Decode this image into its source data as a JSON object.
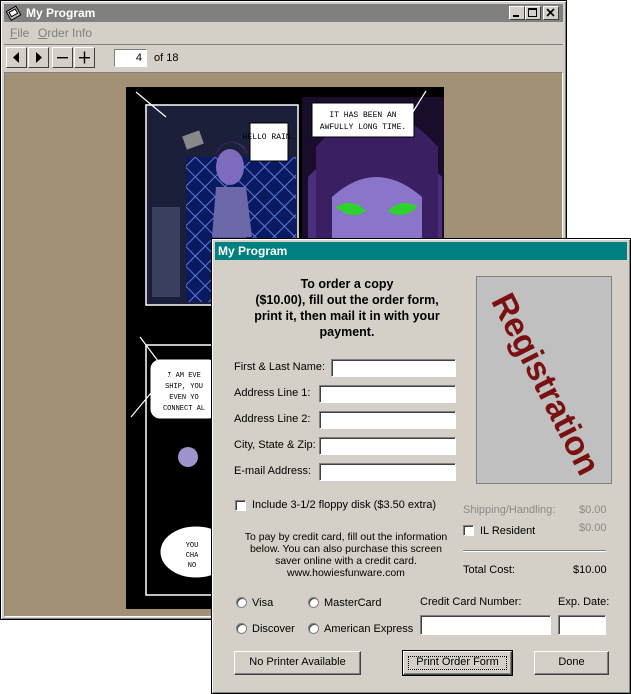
{
  "window": {
    "title": "My Program",
    "menu": [
      "File",
      "Order Info"
    ],
    "toolbar": {
      "page_value": "4",
      "page_of": "of 18"
    },
    "comic_bubbles": [
      "HELLO RAIN.",
      "IT HAS BEEN AN AWFULLY LONG TIME.",
      "I AM EVE SHIP, YOU EVEN YO CONNECT AL",
      "YOU CHA NO"
    ]
  },
  "dialog": {
    "title": "My Program",
    "heading": [
      "To order a copy",
      "($10.00), fill out the order form,",
      "print it, then mail it in with your",
      "payment."
    ],
    "registration_text": "Registration",
    "fields": {
      "name_label": "First & Last Name:",
      "addr1_label": "Address Line 1:",
      "addr2_label": "Address Line 2:",
      "csz_label": "City, State & Zip:",
      "email_label": "E-mail Address:"
    },
    "floppy_label": "Include 3-1/2 floppy disk ($3.50 extra)",
    "shipping_label": "Shipping/Handling:",
    "shipping_value": "$0.00",
    "il_label": "IL Resident",
    "il_value": "$0.00",
    "total_label": "Total Cost:",
    "total_value": "$10.00",
    "info_lines": [
      "To pay by credit card, fill out the information",
      "below. You can also purchase this screen",
      "saver online with a credit card.",
      "www.howiesfunware.com"
    ],
    "cards": {
      "visa": "Visa",
      "mastercard": "MasterCard",
      "discover": "Discover",
      "amex": "American Express"
    },
    "cc_number_label": "Credit Card Number:",
    "exp_label": "Exp. Date:",
    "buttons": {
      "no_printer": "No Printer Available",
      "print": "Print Order Form",
      "done": "Done"
    }
  }
}
